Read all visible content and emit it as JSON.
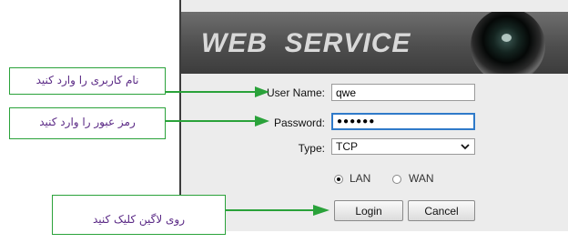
{
  "banner": {
    "title": "WEB  SERVICE"
  },
  "login": {
    "username_label": "User Name:",
    "username_value": "qwe",
    "password_label": "Password:",
    "password_value": "●●●●●●",
    "type_label": "Type:",
    "type_value": "TCP",
    "radio_lan_label": "LAN",
    "radio_wan_label": "WAN",
    "radio_selected": "LAN",
    "login_button": "Login",
    "cancel_button": "Cancel"
  },
  "callouts": {
    "username_hint": "نام کاربری را وارد کنید",
    "password_hint": "رمز عبور را وارد کنید",
    "login_hint": "روی لاگین کلیک کنید"
  },
  "colors": {
    "callout_border": "#2aa23a",
    "callout_text": "#5b2a86",
    "arrow": "#2aa23a",
    "focus_border": "#2f7ac9"
  },
  "icons": {
    "dropdown": "chevron-down-icon",
    "camera": "camera-lens-icon"
  }
}
